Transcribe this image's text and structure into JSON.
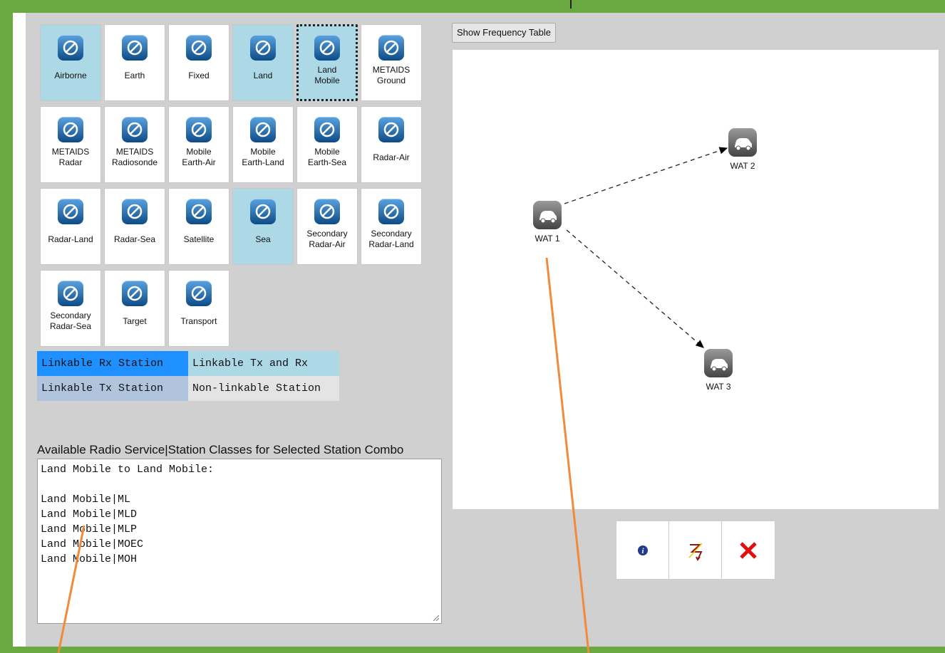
{
  "tiles": [
    {
      "label": "Airborne",
      "kind": "txrx"
    },
    {
      "label": "Earth",
      "kind": "plain"
    },
    {
      "label": "Fixed",
      "kind": "plain"
    },
    {
      "label": "Land",
      "kind": "txrx"
    },
    {
      "label": "Land\nMobile",
      "kind": "txrx-selected"
    },
    {
      "label": "METAIDS\nGround",
      "kind": "plain"
    },
    {
      "label": "METAIDS\nRadar",
      "kind": "plain"
    },
    {
      "label": "METAIDS\nRadiosonde",
      "kind": "plain"
    },
    {
      "label": "Mobile\nEarth-Air",
      "kind": "plain"
    },
    {
      "label": "Mobile\nEarth-Land",
      "kind": "plain"
    },
    {
      "label": "Mobile\nEarth-Sea",
      "kind": "plain"
    },
    {
      "label": "Radar-Air",
      "kind": "plain"
    },
    {
      "label": "Radar-Land",
      "kind": "plain"
    },
    {
      "label": "Radar-Sea",
      "kind": "plain"
    },
    {
      "label": "Satellite",
      "kind": "plain"
    },
    {
      "label": "Sea",
      "kind": "txrx"
    },
    {
      "label": "Secondary\nRadar-Air",
      "kind": "plain"
    },
    {
      "label": "Secondary\nRadar-Land",
      "kind": "plain"
    },
    {
      "label": "Secondary\nRadar-Sea",
      "kind": "plain"
    },
    {
      "label": "Target",
      "kind": "plain"
    },
    {
      "label": "Transport",
      "kind": "plain"
    }
  ],
  "legend": {
    "rx": "Linkable Rx Station",
    "txrx": "Linkable Tx and Rx",
    "tx": "Linkable Tx Station",
    "non": "Non-linkable Station"
  },
  "available": {
    "title": "Available Radio Service|Station Classes for Selected Station Combo",
    "text": "Land Mobile to Land Mobile:\n\nLand Mobile|ML\nLand Mobile|MLD\nLand Mobile|MLP\nLand Mobile|MOEC\nLand Mobile|MOH"
  },
  "toolbar": {
    "freq_button": "Show Frequency Table"
  },
  "diagram": {
    "nodes": [
      "WAT 1",
      "WAT 2",
      "WAT 3"
    ]
  },
  "colors": {
    "frame": "#6aa842",
    "txrx": "#add8e6",
    "rx": "#1e90ff",
    "tx": "#b0c4de",
    "non": "#e4e4e4",
    "callout": "#f08a3c"
  }
}
